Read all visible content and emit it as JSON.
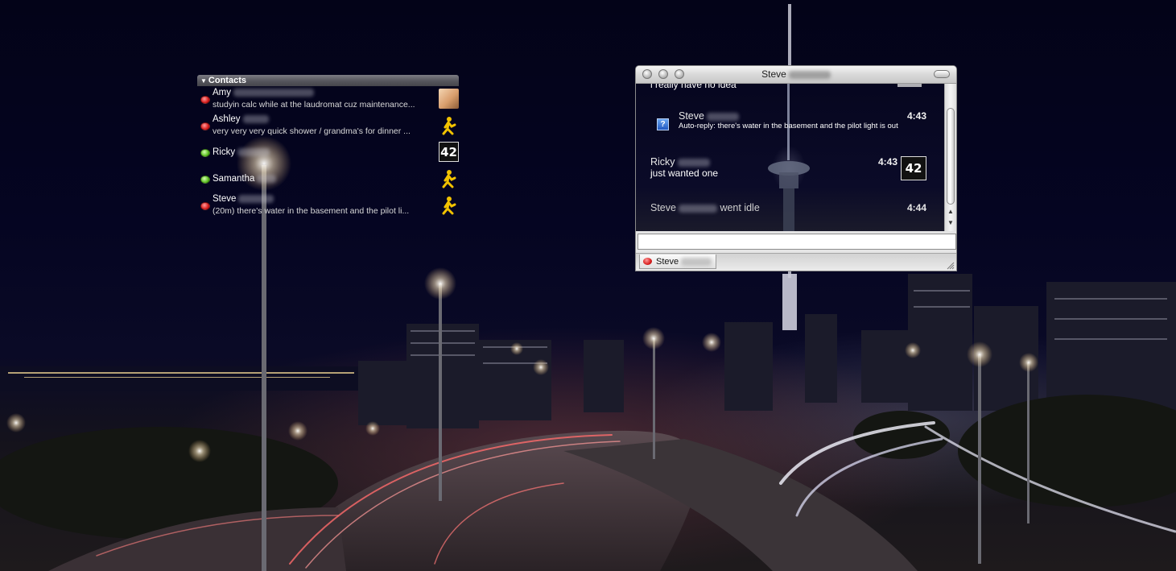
{
  "contacts_list": {
    "header": "Contacts",
    "contacts": [
      {
        "name": "Amy",
        "status": "studyin calc while at the laudromat cuz maintenance...",
        "presence": "away",
        "icon": "photo-buddy-icon"
      },
      {
        "name": "Ashley",
        "status": "very very very quick shower / grandma's for dinner ...",
        "presence": "away",
        "icon": "aim-running-man-icon"
      },
      {
        "name": "Ricky",
        "status": "",
        "presence": "online",
        "icon": "number-42-buddy-icon"
      },
      {
        "name": "Samantha",
        "status": "",
        "presence": "online",
        "icon": "aim-running-man-icon"
      },
      {
        "name": "Steve",
        "status": "(20m) there's water in the basement and the pilot li...",
        "presence": "away",
        "icon": "aim-running-man-icon"
      }
    ]
  },
  "chat_window": {
    "title": "Steve",
    "messages": [
      {
        "sender": "",
        "text": "i really have no idea",
        "time": ""
      },
      {
        "sender": "Steve",
        "text": "Auto-reply: there's water in the basement and the pilot light is out",
        "time": "4:43"
      },
      {
        "sender": "Ricky",
        "text": "just wanted one",
        "time": "4:43"
      },
      {
        "sender": "Steve",
        "text": "went idle",
        "time": "4:44"
      }
    ],
    "buddy_badge": "42",
    "input_value": "",
    "tab_label": "Steve",
    "colors": {
      "away": "#d81d1d",
      "online": "#5cbf22"
    }
  }
}
